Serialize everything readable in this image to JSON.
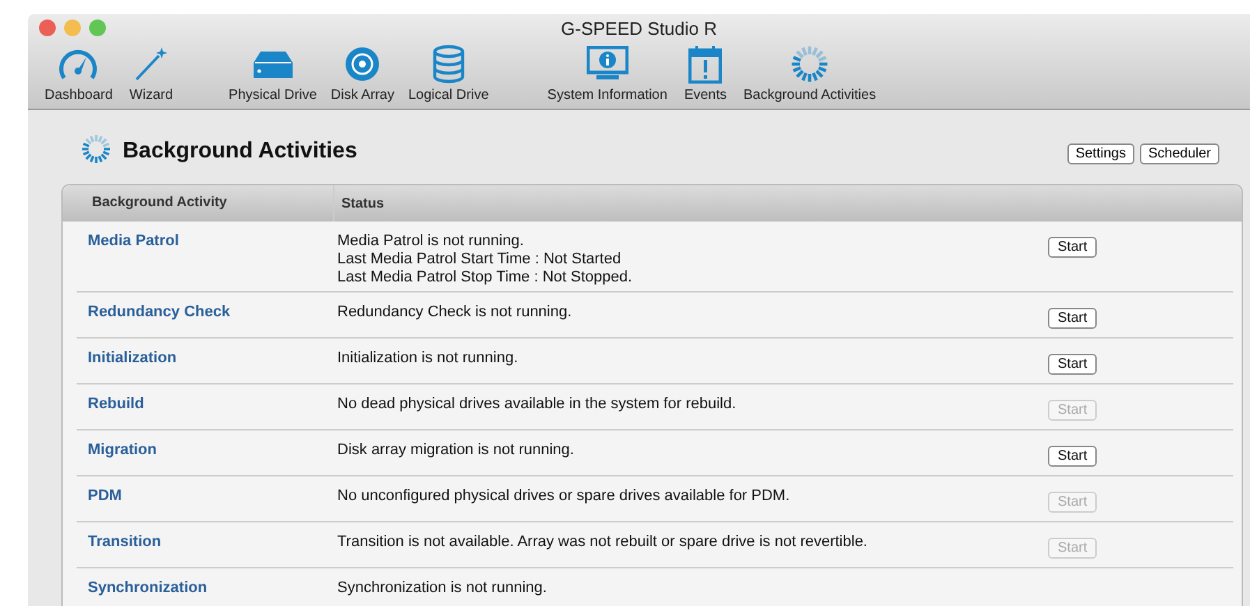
{
  "window": {
    "title": "G-SPEED Studio R"
  },
  "toolbar": [
    {
      "label": "Dashboard"
    },
    {
      "label": "Wizard"
    },
    {
      "label": "Physical Drive"
    },
    {
      "label": "Disk Array"
    },
    {
      "label": "Logical Drive"
    },
    {
      "label": "System Information"
    },
    {
      "label": "Events"
    },
    {
      "label": "Background Activities"
    }
  ],
  "page": {
    "title": "Background Activities",
    "buttons": [
      "Settings",
      "Scheduler"
    ]
  },
  "table": {
    "columns": [
      "Background Activity",
      "Status"
    ],
    "rows": [
      {
        "activity": "Media Patrol",
        "status": [
          "Media Patrol is not running.",
          "Last Media Patrol Start Time : Not Started",
          "Last Media Patrol Stop Time : Not Stopped."
        ],
        "button": {
          "label": "Start",
          "disabled": false
        }
      },
      {
        "activity": "Redundancy Check",
        "status": [
          "Redundancy Check is not running."
        ],
        "button": {
          "label": "Start",
          "disabled": false
        }
      },
      {
        "activity": "Initialization",
        "status": [
          "Initialization is not running."
        ],
        "button": {
          "label": "Start",
          "disabled": false
        }
      },
      {
        "activity": "Rebuild",
        "status": [
          "No dead physical drives available in the system for rebuild."
        ],
        "button": {
          "label": "Start",
          "disabled": true
        }
      },
      {
        "activity": "Migration",
        "status": [
          "Disk array migration is not running."
        ],
        "button": {
          "label": "Start",
          "disabled": false
        }
      },
      {
        "activity": "PDM",
        "status": [
          "No unconfigured physical drives or spare drives available for PDM."
        ],
        "button": {
          "label": "Start",
          "disabled": true
        }
      },
      {
        "activity": "Transition",
        "status": [
          "Transition is not available. Array was not rebuilt or spare drive is not revertible."
        ],
        "button": {
          "label": "Start",
          "disabled": true
        }
      },
      {
        "activity": "Synchronization",
        "status": [
          "Synchronization is not running."
        ]
      }
    ]
  }
}
